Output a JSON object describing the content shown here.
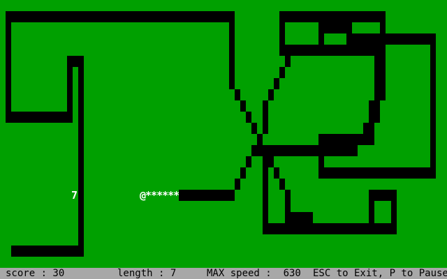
{
  "game": {
    "food_value": "7",
    "snake": {
      "head_glyph": "@",
      "body_glyphs": "******"
    }
  },
  "status_bar": {
    "score": "score : 30",
    "length": "length : 7",
    "max_speed": "MAX speed :  630",
    "help": "ESC to Exit, P to Pause"
  },
  "colors": {
    "field": "#00a000",
    "wall": "#000000",
    "status_bar": "#a8a8a8",
    "snake": "#ffffff"
  }
}
